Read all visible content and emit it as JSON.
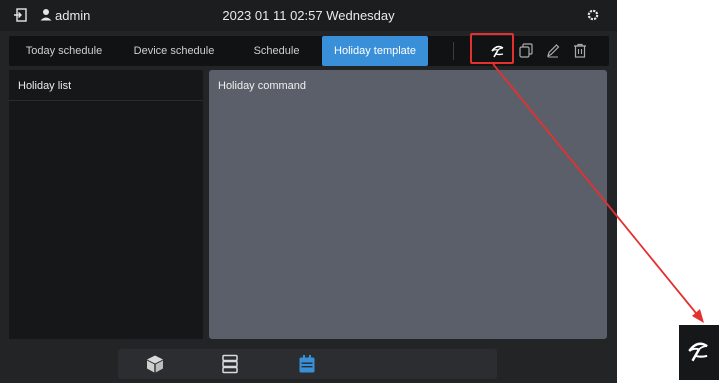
{
  "header": {
    "username": "admin",
    "datetime": "2023 01 11 02:57 Wednesday"
  },
  "tabs": [
    {
      "label": "Today schedule",
      "active": false
    },
    {
      "label": "Device schedule",
      "active": false
    },
    {
      "label": "Schedule",
      "active": false
    },
    {
      "label": "Holiday template",
      "active": true
    }
  ],
  "toolbar": {
    "icons": [
      "holiday-beach-icon",
      "copy-icon",
      "edit-pencil-icon",
      "trash-icon"
    ]
  },
  "left_panel": {
    "title": "Holiday list"
  },
  "right_panel": {
    "title": "Holiday command"
  },
  "bottom_nav": {
    "icons": [
      "cube-icon",
      "server-list-icon",
      "calendar-icon"
    ],
    "active_index": 2
  },
  "colors": {
    "accent": "#3a8fd9",
    "highlight": "#e53030",
    "panel": "#5b5f69",
    "background": "#222426"
  }
}
